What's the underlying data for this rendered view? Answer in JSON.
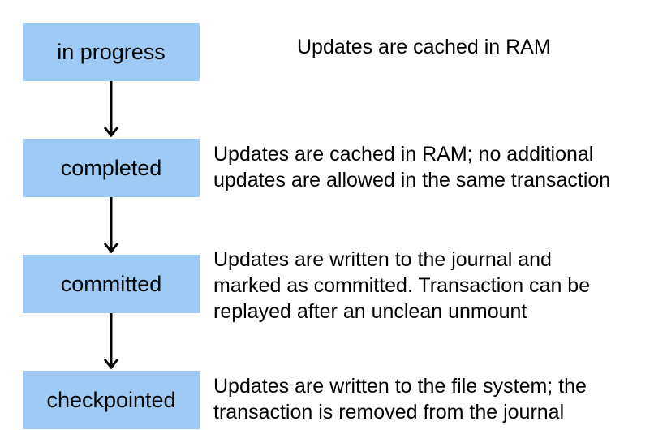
{
  "states": [
    {
      "label": "in progress",
      "description": [
        "Updates are cached in RAM"
      ]
    },
    {
      "label": "completed",
      "description": [
        "Updates are cached in RAM; no additional",
        "updates are allowed in the same transaction"
      ]
    },
    {
      "label": "committed",
      "description": [
        "Updates are written to the journal and",
        "marked as committed. Transaction can be",
        "replayed after an unclean unmount"
      ]
    },
    {
      "label": "checkpointed",
      "description": [
        "Updates are written to the file system; the",
        "transaction is removed from the journal"
      ]
    }
  ],
  "colors": {
    "box_fill": "#9dcbf5",
    "arrow": "#000000",
    "text": "#000000"
  }
}
